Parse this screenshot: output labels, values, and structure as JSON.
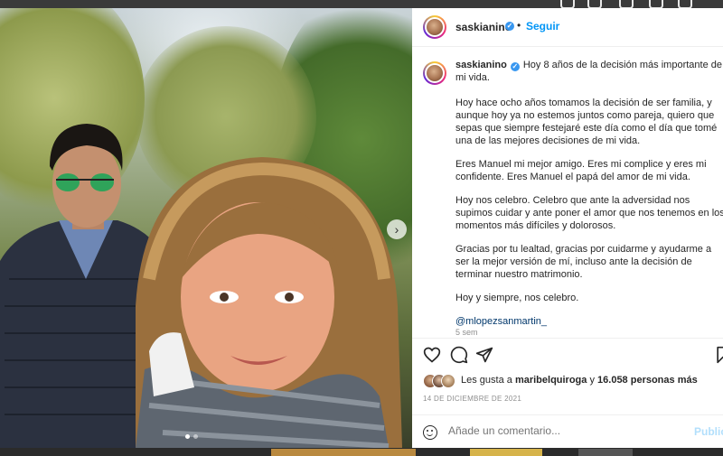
{
  "post": {
    "author": "saskianino",
    "follow_label": "Seguir",
    "separator": "•",
    "caption_first": "Hoy 8 años de la decisión más importante de mi vida.",
    "paragraphs": [
      "Hoy hace ocho años tomamos la decisión de ser familia, y aunque hoy ya no estemos juntos como pareja, quiero que sepas que siempre festejaré este día como el día que tomé una de las mejores decisiones de mi vida.",
      "Eres Manuel mi mejor amigo. Eres mi complice y eres mi confidente. Eres Manuel el papá del amor de mi vida.",
      "Hoy nos celebro. Celebro que ante la adversidad nos supimos cuidar y ante poner el amor que nos tenemos en los momentos más difíciles y dolorosos.",
      "Gracias por tu lealtad, gracias por cuidarme y ayudarme a ser la mejor versión de mí, incluso ante la decisión de terminar nuestro matrimonio.",
      "Hoy y siempre, nos celebro."
    ],
    "mention": "@mlopezsanmartin_",
    "time_ago": "5 sem",
    "likes_prefix": "Les gusta a",
    "likes_user": "maribelquiroga",
    "likes_connector": "y",
    "likes_count": "16.058 personas más",
    "date": "14 DE DICIEMBRE DE 2021",
    "comment_placeholder": "Añade un comentario...",
    "publish_label": "Publicar",
    "carousel_dots": 2,
    "carousel_active": 0
  },
  "icons": {
    "verified": "verified-badge-icon",
    "like": "heart-icon",
    "comment": "comment-icon",
    "share": "paper-plane-icon",
    "save": "bookmark-icon",
    "emoji": "smiley-icon",
    "next": "chevron-right-icon"
  },
  "colors": {
    "follow": "#0095f6",
    "verified": "#3897f0",
    "publish_disabled": "#b2dffc",
    "muted": "#8e8e8e"
  }
}
